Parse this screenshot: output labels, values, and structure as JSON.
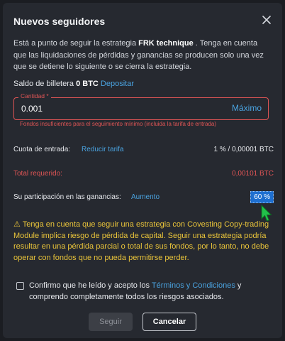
{
  "modal": {
    "title": "Nuevos seguidores",
    "intro_prefix": "Está a punto de seguir la estrategia ",
    "strategy_name": "FRK technique",
    "intro_suffix": " . Tenga en cuenta que las liquidaciones de pérdidas y ganancias se producen solo una vez que se detiene lo siguiente o se cierra la estrategia."
  },
  "wallet": {
    "label": "Saldo de billetera",
    "balance": "0 BTC",
    "deposit_label": "Depositar"
  },
  "quantity": {
    "label": "Cantidad *",
    "value": "0.001",
    "max_label": "Máximo",
    "error": "Fondos insuficientes para el seguimiento mínimo (incluida la tarifa de entrada)"
  },
  "entry_fee": {
    "label": "Cuota de entrada:",
    "action": "Reducir tarifa",
    "value": "1 % / 0,00001 BTC"
  },
  "total": {
    "label": "Total requerido:",
    "value": "0,00101 BTC"
  },
  "profit_share": {
    "label": "Su participación en las ganancias:",
    "action": "Aumento",
    "value": "60 %"
  },
  "warning_text": "⚠ Tenga en cuenta que seguir una estrategia con Covesting Copy-trading Module implica riesgo de pérdida de capital. Seguir una estrategia podría resultar en una pérdida parcial o total de sus fondos, por lo tanto, no debe operar con fondos que no pueda permitirse perder.",
  "confirm": {
    "prefix": "Confirmo que he leído y acepto los ",
    "terms_link": "Términos y Condiciones",
    "suffix": " y comprendo completamente todos los riesgos asociados."
  },
  "buttons": {
    "follow": "Seguir",
    "cancel": "Cancelar"
  },
  "colors": {
    "accent": "#4aa3e0",
    "error": "#e05555",
    "warning": "#e8c33a",
    "cursor": "#22c24a"
  }
}
